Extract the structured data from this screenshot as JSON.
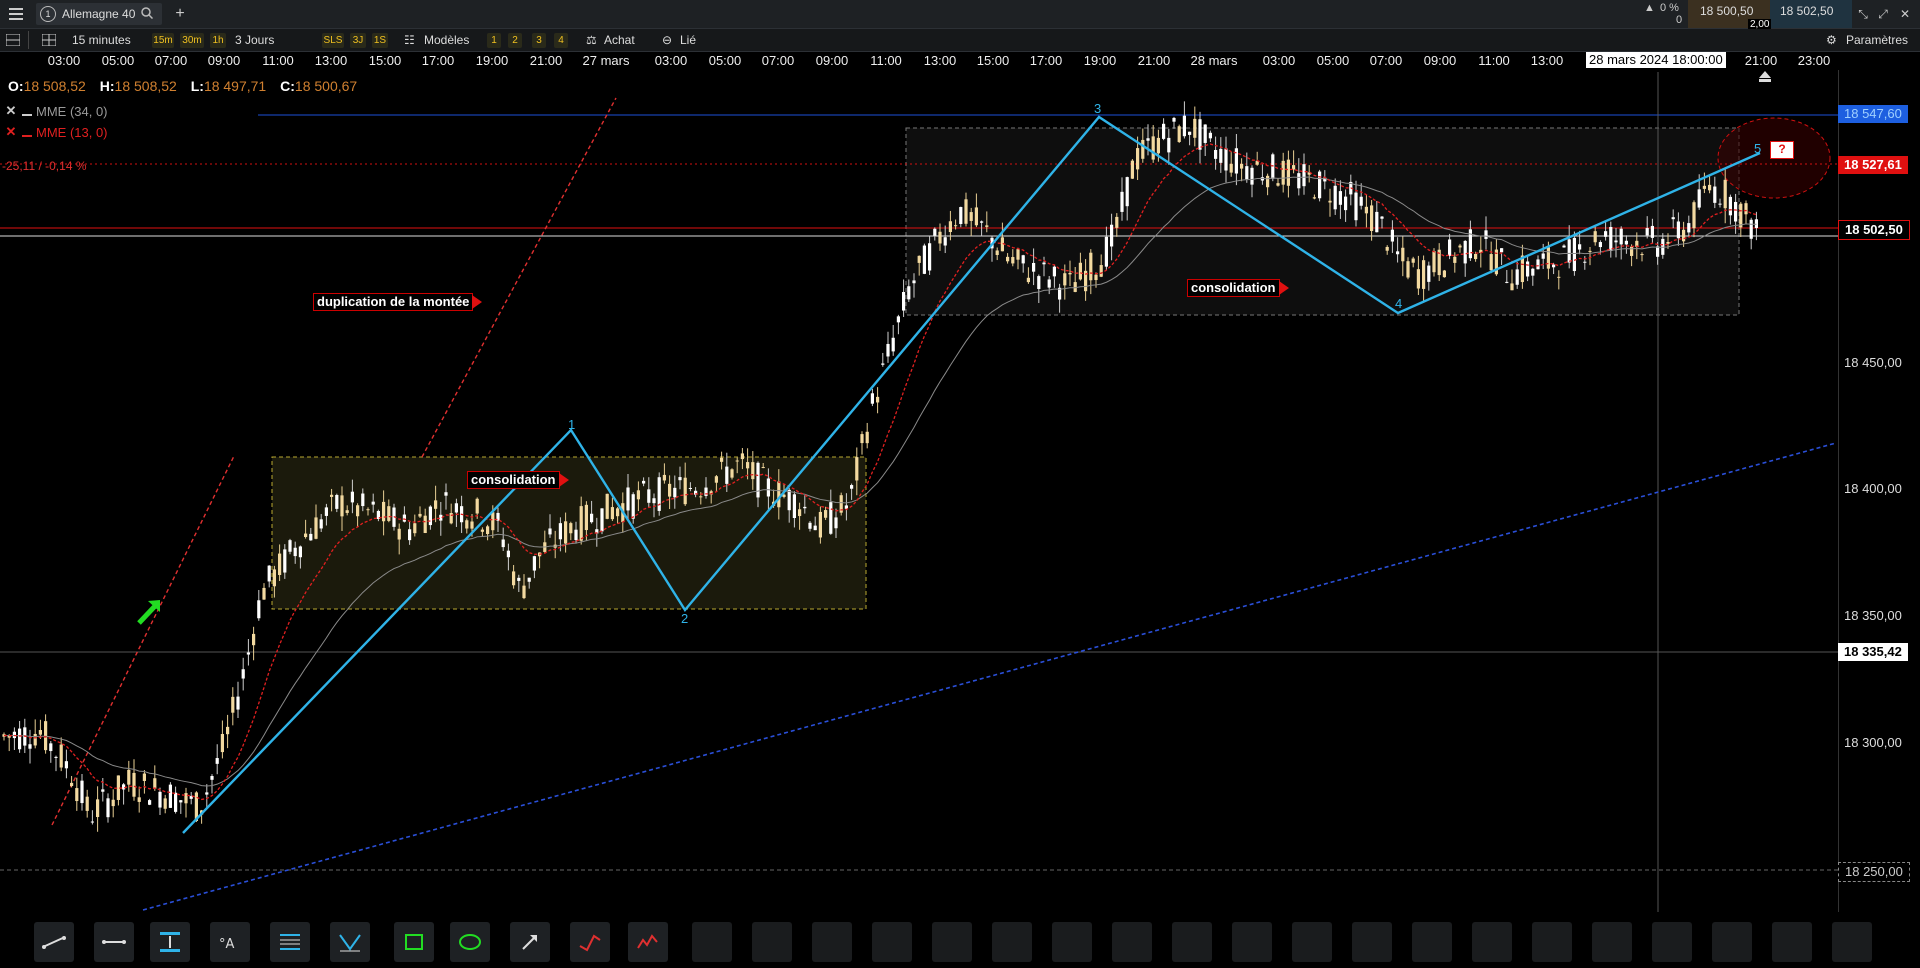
{
  "window": {
    "menu_icon": "hamburger-icon",
    "tab_number": "1",
    "tab_title": "Allemagne 40",
    "add_tab": "+"
  },
  "quote": {
    "pct_top": "0 %",
    "pct_bottom": "0",
    "bid": "18 500,50",
    "ask": "18 502,50",
    "spread": "2,00"
  },
  "toolbar": {
    "interval": "15 minutes",
    "timeframes": [
      "15m",
      "30m",
      "1h"
    ],
    "period": "3 Jours",
    "chips": [
      "SLS",
      "3J",
      "1S"
    ],
    "models_label": "Modèles",
    "layouts": [
      "1",
      "2",
      "3",
      "4"
    ],
    "buy_label": "Achat",
    "linked_label": "Lié",
    "settings_label": "Paramètres"
  },
  "time_axis": [
    "03:00",
    "05:00",
    "07:00",
    "09:00",
    "11:00",
    "13:00",
    "15:00",
    "17:00",
    "19:00",
    "21:00",
    "27 mars",
    "03:00",
    "05:00",
    "07:00",
    "09:00",
    "11:00",
    "13:00",
    "15:00",
    "17:00",
    "19:00",
    "21:00",
    "28 mars",
    "03:00",
    "05:00",
    "07:00",
    "09:00",
    "11:00",
    "13:00",
    "21:00",
    "23:00"
  ],
  "cursor_time": "28 mars 2024 18:00:00",
  "ohlc": {
    "o_label": "O:",
    "o": "18 508,52",
    "h_label": "H:",
    "h": "18 508,52",
    "l_label": "L:",
    "l": "18 497,71",
    "c_label": "C:",
    "c": "18 500,67"
  },
  "indicators": [
    {
      "name": "MME (34, 0)",
      "color": "#9a9a9a"
    },
    {
      "name": "MME (13, 0)",
      "color": "#e02020"
    }
  ],
  "variation": "-25,11 / -0,14 %",
  "price_axis": {
    "levels": [
      "18 450,00",
      "18 400,00",
      "18 350,00",
      "18 300,00"
    ],
    "resistance": "18 547,60",
    "marker_red": "18 527,61",
    "last": "18 502,50",
    "cursor": "18 335,42",
    "bottom": "18 250,00"
  },
  "annotations": {
    "duplication": "duplication de la montée",
    "consolidation_1": "consolidation",
    "consolidation_2": "consolidation",
    "question": "?"
  },
  "waves": [
    "1",
    "2",
    "3",
    "4",
    "5"
  ],
  "colors": {
    "up_candle": "#f2d9a0",
    "down_candle": "#ffffff",
    "wave_line": "#2fb3e8",
    "accent_red": "#e01010",
    "trend_blue": "#2a4fd8"
  },
  "bottom_tools": [
    "trendline-icon",
    "horizontal-line-icon",
    "text-marker-icon",
    "annotation-icon",
    "fibonacci-icon",
    "pattern-icon",
    "rectangle-icon",
    "ellipse-icon",
    "arrow-icon",
    "wave-icon",
    "elliott-icon"
  ]
}
